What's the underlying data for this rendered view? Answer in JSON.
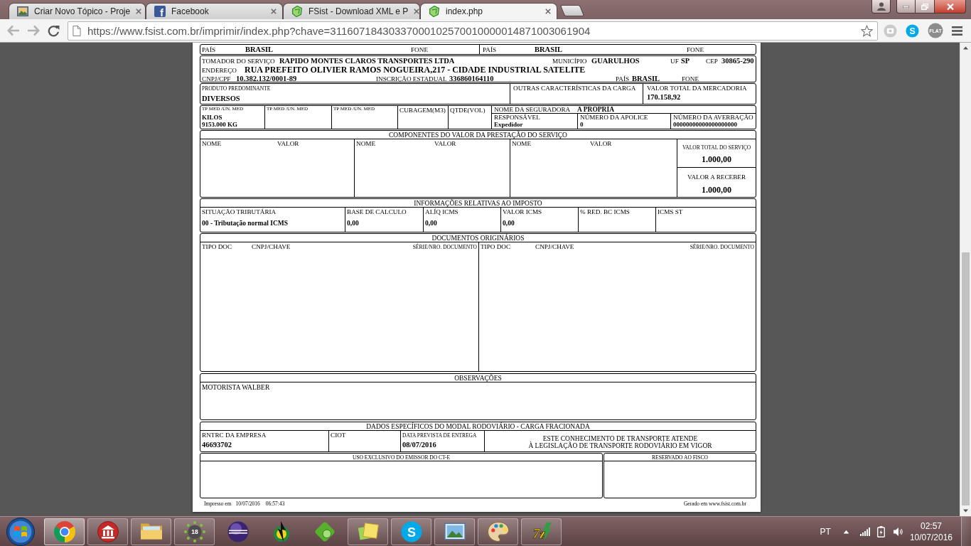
{
  "browser": {
    "tabs": [
      {
        "title": "Criar Novo Tópico - Proje",
        "kind": "picture",
        "selected": false
      },
      {
        "title": "Facebook",
        "kind": "letter",
        "glyph": "f",
        "selected": false
      },
      {
        "title": "FSist - Download XML e P",
        "kind": "leaf",
        "selected": false
      },
      {
        "title": "index.php",
        "kind": "leaf",
        "selected": true
      }
    ],
    "url": "https://www.fsist.com.br/imprimir/index.php?chave=31160718430337000102570010000014871003061904",
    "extensions": [
      {
        "kind": "camera"
      },
      {
        "kind": "chat",
        "glyph": "S"
      },
      {
        "kind": "badge",
        "glyph": "FLAT"
      }
    ]
  },
  "document": {
    "parties_row": [
      {
        "country_label": "PAÍS",
        "country": "BRASIL",
        "phone_label": "FONE"
      },
      {
        "country_label": "PAÍS",
        "country": "BRASIL",
        "phone_label": "FONE"
      }
    ],
    "tomador": {
      "label": "TOMADOR DO SERVIÇO",
      "name": "RAPIDO MONTES CLAROS TRANSPORTES LTDA",
      "city_label": "MUNICÍPIO",
      "city": "GUARULHOS",
      "uf_label": "UF",
      "uf": "SP",
      "cep_label": "CEP",
      "cep": "30865-290",
      "address_label": "ENDEREÇO",
      "address": "RUA PREFEITO OLIVIER RAMOS NOGUEIRA,217 - CIDADE INDUSTRIAL SATELITE",
      "cnpj_label": "CNPJ/CPF",
      "cnpj": "10.382.132/0001-89",
      "ie_label": "INSCRIÇÃO ESTADUAL",
      "ie": "336860164110",
      "country_label": "PAÍS",
      "country": "BRASIL",
      "phone_label": "FONE"
    },
    "cargo": {
      "product_label": "PRODUTO PREDOMINANTE",
      "product": "DIVERSOS",
      "other_label": "OUTRAS CARACTERÍSTICAS DA CARGA",
      "total_label": "VALOR TOTAL DA MERCADORIA",
      "total": "170.158,92"
    },
    "measures": {
      "units": [
        {
          "label": "TP MED /UN. MED",
          "values": [
            "KILOS",
            "9153.000 KG"
          ]
        },
        {
          "label": "TP MED /UN. MED"
        },
        {
          "label": "TP MED /UN. MED"
        }
      ],
      "volumes": [
        {
          "label": "CUBAGEM(M3)"
        },
        {
          "label": "QTDE(VOL)"
        }
      ]
    },
    "insurance": {
      "insurer_label": "NOME DA SEGURADORA",
      "insurer": "A PROPRIA",
      "cells": [
        {
          "label": "RESPONSÁVEL",
          "value": "Expedidor"
        },
        {
          "label": "NÚMERO DA APOLICE",
          "value": "0"
        },
        {
          "label": "NÚMERO DA AVERBAÇÃO",
          "value": "00000000000000000000"
        }
      ]
    },
    "components": {
      "title": "COMPONENTES DO VALOR DA PRESTAÇÃO DO SERVIÇO",
      "columns": [
        {
          "name_label": "NOME",
          "value_label": "VALOR"
        },
        {
          "name_label": "NOME",
          "value_label": "VALOR"
        },
        {
          "name_label": "NOME",
          "value_label": "VALOR"
        }
      ],
      "totals": [
        {
          "label": "VALOR TOTAL DO SERVIÇO",
          "value": "1.000,00"
        },
        {
          "label": "VALOR A RECEBER",
          "value": "1.000,00"
        }
      ]
    },
    "tax": {
      "title": "INFORMAÇÕES RELATIVAS AO IMPOSTO",
      "cells": [
        {
          "label": "SITUAÇÃO TRIBUTÁRIA",
          "value": "00 - Tributação normal ICMS"
        },
        {
          "label": "BASE DE CALCULO",
          "value": "0,00"
        },
        {
          "label": "ALÍQ ICMS",
          "value": "0,00"
        },
        {
          "label": "VALOR ICMS",
          "value": "0,00"
        },
        {
          "label": "% RED. BC ICMS"
        },
        {
          "label": "ICMS ST"
        }
      ]
    },
    "origin_docs": {
      "title": "DOCUMENTOS ORIGINÁRIOS",
      "columns": [
        {
          "type_label": "TIPO DOC",
          "key_label": "CNPJ/CHAVE",
          "number_label": "SÉRIE/NRO. DOCUMENTO"
        },
        {
          "type_label": "TIPO DOC",
          "key_label": "CNPJ/CHAVE",
          "number_label": "SÉRIE/NRO. DOCUMENTO"
        }
      ]
    },
    "observations": {
      "title": "OBSERVAÇÕES",
      "text": "MOTORISTA WALBER"
    },
    "modal": {
      "title": "DADOS ESPECÍFICOS DO MODAL RODOVIÁRIO - CARGA FRACIONADA",
      "cells": [
        {
          "label": "RNTRC DA EMPRESA",
          "value": "46693702"
        },
        {
          "label": "CIOT"
        },
        {
          "label": "DATA PREVISTA DE ENTREGA",
          "value": "08/07/2016"
        }
      ],
      "notice": "ESTE CONHECIMENTO DE TRANSPORTE ATENDE\nÀ LEGISLAÇÃO DE TRANSPORTE RODOVIÁRIO EM VIGOR"
    },
    "reserved": [
      {
        "title": "USO EXCLUSIVO DO EMISSOR DO CT-E"
      },
      {
        "title": "RESERVADO AO FISCO"
      }
    ],
    "footer": {
      "printed_label": "Impresso em",
      "printed_date": "10/07/2016",
      "printed_time": "06:57:43",
      "generated": "Gerado em www.fsist.com.br"
    }
  },
  "taskbar": {
    "apps": [
      {
        "kind": "browser",
        "running": true,
        "selected": true
      },
      {
        "kind": "bank",
        "running": true,
        "selected": false
      },
      {
        "kind": "folder",
        "running": true,
        "selected": false
      },
      {
        "kind": "dots",
        "glyph": "18",
        "running": true,
        "selected": false
      },
      {
        "kind": "orb",
        "running": false,
        "selected": false
      },
      {
        "kind": "figure",
        "running": false,
        "selected": false
      },
      {
        "kind": "gem",
        "running": false,
        "selected": false
      },
      {
        "kind": "notes",
        "running": true,
        "selected": false
      },
      {
        "kind": "chat",
        "glyph": "S",
        "running": true,
        "selected": false
      },
      {
        "kind": "picture",
        "running": true,
        "selected": false
      },
      {
        "kind": "palette",
        "running": true,
        "selected": false
      },
      {
        "kind": "archive",
        "glyph": "7z",
        "running": true,
        "selected": false
      }
    ],
    "language": "PT",
    "time": "02:57",
    "date": "10/07/2016"
  }
}
